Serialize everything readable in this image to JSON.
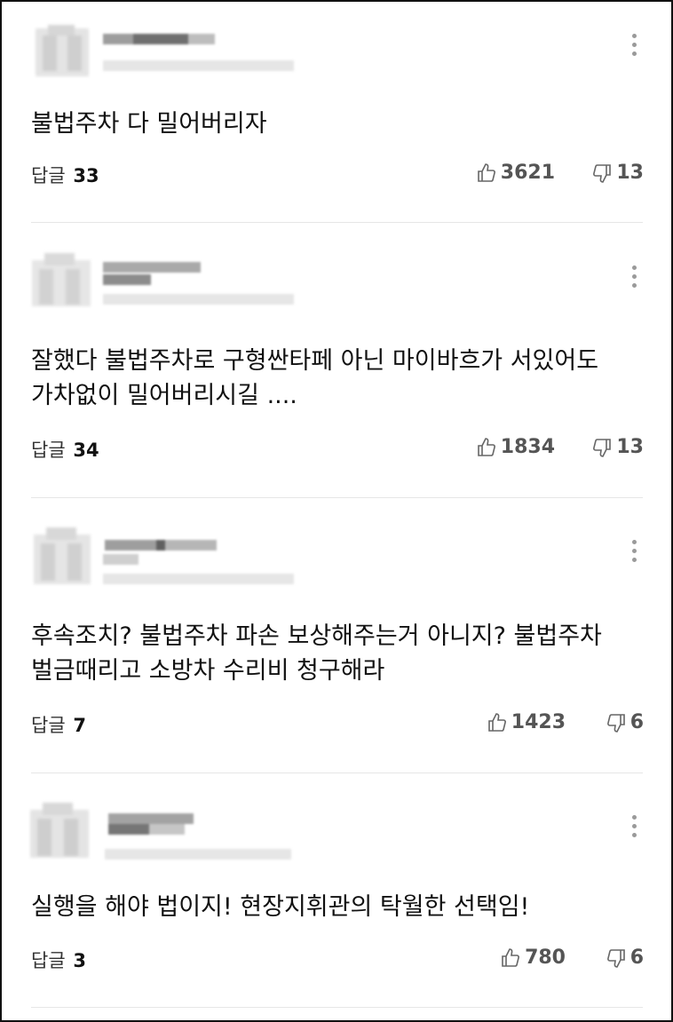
{
  "reply_label": "답글",
  "comments": [
    {
      "text": "불법주차 다 밀어버리자",
      "reply_count": "33",
      "likes": "3621",
      "dislikes": "13"
    },
    {
      "text": "잘했다 불법주차로 구형싼타페 아닌 마이바흐가 서있어도 가차없이 밀어버리시길 ....",
      "reply_count": "34",
      "likes": "1834",
      "dislikes": "13"
    },
    {
      "text": "후속조치? 불법주차 파손 보상해주는거 아니지? 불법주차 벌금때리고 소방차 수리비 청구해라",
      "reply_count": "7",
      "likes": "1423",
      "dislikes": "6"
    },
    {
      "text": "실행을 해야 법이지! 현장지휘관의 탁월한 선택임!",
      "reply_count": "3",
      "likes": "780",
      "dislikes": "6"
    }
  ],
  "icons": {
    "like": "thumbs-up-outline",
    "dislike": "thumbs-down-outline",
    "more": "vertical-ellipsis"
  },
  "colors": {
    "text": "#111111",
    "muted": "#555555",
    "divider": "#e6e6e6",
    "border": "#111111"
  }
}
